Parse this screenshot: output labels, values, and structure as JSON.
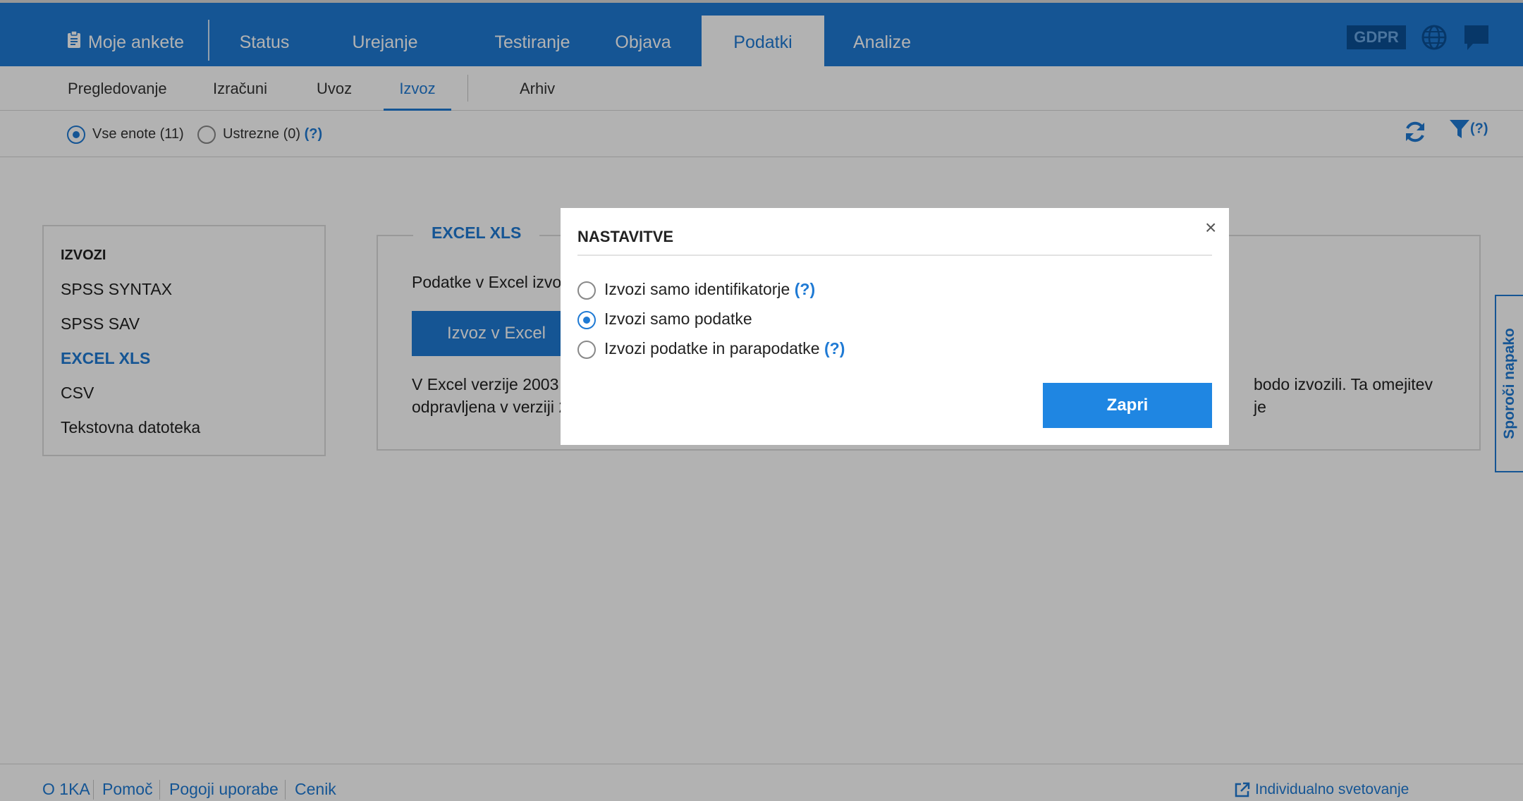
{
  "topnav": {
    "my_surveys": "Moje ankete",
    "tabs": [
      "Status",
      "Urejanje",
      "Testiranje",
      "Objava",
      "Podatki",
      "Analize"
    ],
    "active_tab": "Podatki",
    "gdpr": "GDPR"
  },
  "subnav": {
    "items": [
      "Pregledovanje",
      "Izračuni",
      "Uvoz",
      "Izvoz",
      "Arhiv"
    ],
    "active": "Izvoz"
  },
  "filters": {
    "all_units": "Vse enote (11)",
    "matching": "Ustrezne (0)",
    "help": "(?)",
    "filter_help": "(?)"
  },
  "sidebar": {
    "title": "IZVOZI",
    "items": [
      "SPSS SYNTAX",
      "SPSS SAV",
      "EXCEL XLS",
      "CSV",
      "Tekstovna datoteka"
    ],
    "active": "EXCEL XLS"
  },
  "panel": {
    "legend": "EXCEL XLS",
    "intro": "Podatke v Excel izvozi",
    "export_button": "Izvoz v Excel",
    "note_line1_start": "V Excel verzije 2003 al",
    "note_line1_end": "bodo izvozili. Ta omejitev je",
    "note_line2_start": "odpravljena v verziji 2"
  },
  "report_tab": "Sporoči napako",
  "footer": {
    "links": [
      "O 1KA",
      "Pomoč",
      "Pogoji uporabe",
      "Cenik"
    ],
    "right": "Individualno svetovanje"
  },
  "modal": {
    "title": "NASTAVITVE",
    "close": "×",
    "options": [
      {
        "label": "Izvozi samo identifikatorje",
        "help": "(?)",
        "selected": false
      },
      {
        "label": "Izvozi samo podatke",
        "help": "",
        "selected": true
      },
      {
        "label": "Izvozi podatke in parapodatke",
        "help": "(?)",
        "selected": false
      }
    ],
    "close_button": "Zapri"
  },
  "colors": {
    "primary": "#1f7ad4",
    "button": "#1f86e2",
    "gdpr_bg": "#0b4f96"
  }
}
